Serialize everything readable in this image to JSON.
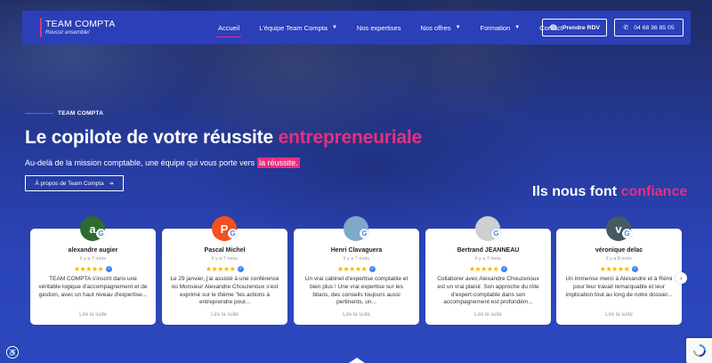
{
  "header": {
    "logo_title": "TEAM COMPTA",
    "logo_subtitle": "Réussir ensemble!",
    "nav": [
      {
        "label": "Accueil"
      },
      {
        "label": "L'équipe Team Compta"
      },
      {
        "label": "Nos expertises"
      },
      {
        "label": "Nos offres"
      },
      {
        "label": "Formation"
      },
      {
        "label": "Contact"
      }
    ],
    "rdv_label": "Prendre RDV",
    "phone_label": "04 68 36 85 05"
  },
  "hero": {
    "tag": "TEAM COMPTA",
    "headline": "Le copilote de votre réussite",
    "headline_highlight": "entrepreneuriale",
    "subline": "Au-delà de la mission comptable, une équipe qui vous porte vers",
    "subline_highlight": "la réussite.",
    "cta_label": "À propos de Team Compta",
    "trust_prefix": "Ils nous font",
    "trust_highlight": "confiance"
  },
  "reviews": [
    {
      "initial": "a",
      "avatar_color": "#2e6b2e",
      "name": "alexandre augier",
      "date": "il y a 7 mois",
      "stars": "★★★★★",
      "text": "TEAM COMPTA s'inscrit dans une véritable logique d'accompagnement et de gestion, avec un haut niveau d'expertise...",
      "more": "Lire la suite"
    },
    {
      "initial": "P",
      "avatar_color": "#f4511e",
      "name": "Pascal Michel",
      "date": "il y a 7 mois",
      "stars": "★★★★★",
      "text": "Le 29 janvier, j'ai assisté à une conférence où Monsieur Alexandre Chouzenoux s'est exprimé sur le thème \"les actions à entreprendre pour...",
      "more": "Lire la suite"
    },
    {
      "initial": "",
      "avatar_color": "#7fa8c9",
      "name": "Henri Clavaguera",
      "date": "il y a 7 mois",
      "stars": "★★★★★",
      "text": "Un vrai cabinet d'expertise comptable et bien plus ! Une vrai expertise sur les bilans, des conseils toujours aussi pertinents, un...",
      "more": "Lire la suite"
    },
    {
      "initial": "",
      "avatar_color": "#cfcfcf",
      "name": "Bertrand JEANNEAU",
      "date": "il y a 7 mois",
      "stars": "★★★★★",
      "text": "Collaborer avec Alexandre Chouzenoux est un vrai plaisir. Son approche du rôle d'expert-comptable dans son accompagnement est profondém...",
      "more": "Lire la suite"
    },
    {
      "initial": "v",
      "avatar_color": "#455a64",
      "name": "véronique delac",
      "date": "il y a 8 mois",
      "stars": "★★★★★",
      "text": "Un immense merci à Alexandre et à Rémi pour leur travail remarquable et leur implication tout au long de notre dossier...",
      "more": "Lire la suite"
    }
  ],
  "icons": {
    "next": "chevron-right-icon",
    "accessibility": "accessibility-icon",
    "recaptcha": "recaptcha-icon"
  }
}
